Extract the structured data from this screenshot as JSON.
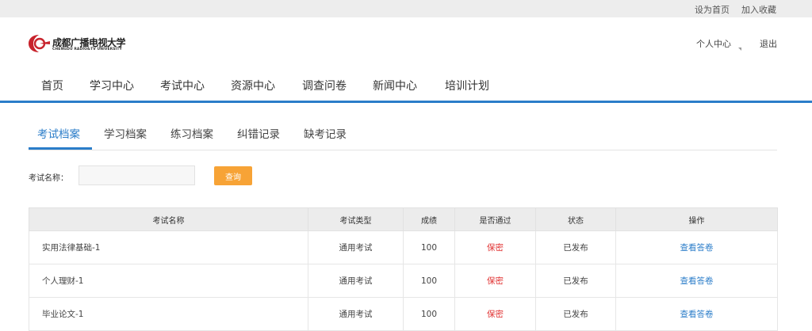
{
  "topbar": {
    "set_home": "设为首页",
    "add_favorite": "加入收藏"
  },
  "logo": {
    "name_cn": "成都广播电视大学",
    "name_en": "CHENGDU RADIO&TV UNIVERSITY"
  },
  "user_menu": {
    "user_center": "个人中心",
    "logout": "退出"
  },
  "nav": {
    "items": [
      "首页",
      "学习中心",
      "考试中心",
      "资源中心",
      "调查问卷",
      "新闻中心",
      "培训计划"
    ]
  },
  "subtabs": {
    "items": [
      "考试档案",
      "学习档案",
      "练习档案",
      "纠错记录",
      "缺考记录"
    ],
    "active_index": 0
  },
  "search": {
    "label": "考试名称：",
    "value": "",
    "placeholder": "",
    "button": "查询"
  },
  "table": {
    "headers": [
      "考试名称",
      "考试类型",
      "成绩",
      "是否通过",
      "状态",
      "操作"
    ],
    "rows": [
      {
        "name": "实用法律基础-1",
        "type": "通用考试",
        "score": "100",
        "passed": "保密",
        "status": "已发布",
        "action": "查看答卷"
      },
      {
        "name": "个人理财-1",
        "type": "通用考试",
        "score": "100",
        "passed": "保密",
        "status": "已发布",
        "action": "查看答卷"
      },
      {
        "name": "毕业论文-1",
        "type": "通用考试",
        "score": "100",
        "passed": "保密",
        "status": "已发布",
        "action": "查看答卷"
      }
    ]
  },
  "colors": {
    "accent_blue": "#2b7dc9",
    "search_button": "#f7a336",
    "secret_red": "#e03030",
    "logo_red": "#c8232c"
  },
  "icons": {
    "logo": "university-logo-icon",
    "dropdown": "caret-down-icon"
  }
}
